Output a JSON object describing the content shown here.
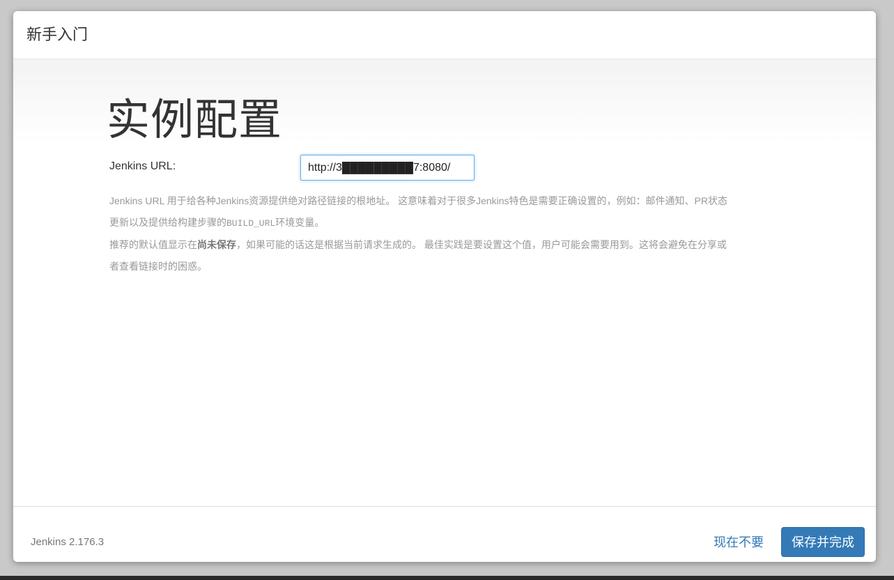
{
  "dialog": {
    "title": "新手入门"
  },
  "main": {
    "heading": "实例配置",
    "url_label": "Jenkins URL:",
    "url_value": "http://3█████████7:8080/",
    "description": {
      "line1": "Jenkins URL 用于给各种Jenkins资源提供绝对路径链接的根地址。 这意味着对于很多Jenkins特色是需要正确设置的，例如：邮件通知、PR状态",
      "line2_prefix": "更新以及提供给构建步骤的",
      "line2_code": "BUILD_URL",
      "line2_suffix": "环境变量。",
      "line3_prefix": "推荐的默认值显示在",
      "line3_strong": "尚未保存",
      "line3_suffix": "，如果可能的话这是根据当前请求生成的。 最佳实践是要设置这个值，用户可能会需要用到。这将会避免在分享或",
      "line4": "者查看链接时的困惑。"
    }
  },
  "footer": {
    "version": "Jenkins 2.176.3",
    "skip_label": "现在不要",
    "save_label": "保存并完成"
  },
  "colors": {
    "primary": "#337ab7",
    "input_focus": "#66afe9"
  }
}
